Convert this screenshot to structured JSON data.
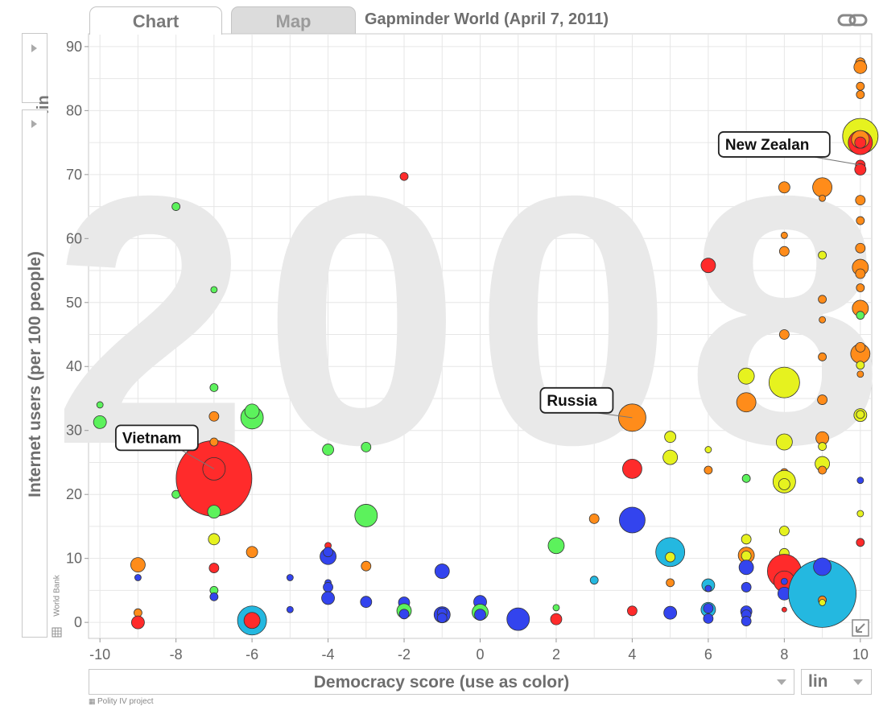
{
  "tabs": {
    "chart": "Chart",
    "map": "Map"
  },
  "title": "Gapminder World (April 7, 2011)",
  "icons": {
    "link": "link-icon",
    "expand": "expand-icon",
    "y_menu": "triangle-right-icon",
    "x_menu": "triangle-down-icon"
  },
  "y_scale": "lin",
  "x_scale": "lin",
  "y_axis_label": "Internet users (per 100 people)",
  "x_axis_label": "Democracy score (use as color)",
  "y_source": "World Bank",
  "x_source": "Polity IV project",
  "chart_data": {
    "type": "scatter",
    "year_watermark": "2008",
    "xlim": [
      -10.3,
      10.3
    ],
    "ylim": [
      -2.5,
      92
    ],
    "xticks": [
      -10,
      -8,
      -6,
      -4,
      -2,
      0,
      2,
      4,
      6,
      8,
      10
    ],
    "yticks": [
      0,
      10,
      20,
      30,
      40,
      50,
      60,
      70,
      80,
      90
    ],
    "grid": true,
    "color_scale": {
      "red": "#ff2b2b",
      "orange": "#ff8c1a",
      "yellow": "#e6f21f",
      "green": "#5cf25c",
      "cyan": "#24b8e0",
      "blue": "#3344ee"
    },
    "labels": [
      {
        "text": "Vietnam",
        "x": -7,
        "y": 24
      },
      {
        "text": "Russia",
        "x": 4,
        "y": 32
      },
      {
        "text": "New Zealan",
        "x": 10,
        "y": 71.5
      }
    ],
    "points": [
      {
        "x": -10,
        "y": 31.3,
        "r": 8,
        "c": "green"
      },
      {
        "x": -10,
        "y": 34,
        "r": 4,
        "c": "green"
      },
      {
        "x": -9,
        "y": 9,
        "r": 9,
        "c": "orange"
      },
      {
        "x": -9,
        "y": 7,
        "r": 4,
        "c": "blue"
      },
      {
        "x": -9,
        "y": 1.5,
        "r": 5,
        "c": "orange"
      },
      {
        "x": -9,
        "y": 0,
        "r": 8,
        "c": "red"
      },
      {
        "x": -8,
        "y": 65,
        "r": 5,
        "c": "green"
      },
      {
        "x": -8,
        "y": 20,
        "r": 5,
        "c": "green"
      },
      {
        "x": -7,
        "y": 22.5,
        "r": 47,
        "c": "red"
      },
      {
        "x": -7,
        "y": 24,
        "r": 14,
        "c": "red"
      },
      {
        "x": -7,
        "y": 52,
        "r": 4,
        "c": "green"
      },
      {
        "x": -7,
        "y": 36.7,
        "r": 5,
        "c": "green"
      },
      {
        "x": -7,
        "y": 32.2,
        "r": 6,
        "c": "orange"
      },
      {
        "x": -7,
        "y": 28.2,
        "r": 5,
        "c": "orange"
      },
      {
        "x": -7,
        "y": 17.3,
        "r": 8,
        "c": "green"
      },
      {
        "x": -7,
        "y": 13,
        "r": 7,
        "c": "yellow"
      },
      {
        "x": -7,
        "y": 8.5,
        "r": 6,
        "c": "red"
      },
      {
        "x": -7,
        "y": 5,
        "r": 5,
        "c": "green"
      },
      {
        "x": -7,
        "y": 4,
        "r": 5,
        "c": "blue"
      },
      {
        "x": -6,
        "y": 32,
        "r": 14,
        "c": "green"
      },
      {
        "x": -6,
        "y": 33,
        "r": 9,
        "c": "green"
      },
      {
        "x": -6,
        "y": 11,
        "r": 7,
        "c": "orange"
      },
      {
        "x": -6,
        "y": 0.3,
        "r": 18,
        "c": "cyan"
      },
      {
        "x": -6,
        "y": 0.3,
        "r": 10,
        "c": "red"
      },
      {
        "x": -5,
        "y": 7,
        "r": 4,
        "c": "blue"
      },
      {
        "x": -5,
        "y": 2,
        "r": 4,
        "c": "blue"
      },
      {
        "x": -4,
        "y": 27,
        "r": 7,
        "c": "green"
      },
      {
        "x": -4,
        "y": 12,
        "r": 4,
        "c": "red"
      },
      {
        "x": -4,
        "y": 10.3,
        "r": 10,
        "c": "blue"
      },
      {
        "x": -4,
        "y": 11,
        "r": 6,
        "c": "blue"
      },
      {
        "x": -4,
        "y": 6.2,
        "r": 4,
        "c": "blue"
      },
      {
        "x": -4,
        "y": 5.5,
        "r": 6,
        "c": "blue"
      },
      {
        "x": -4,
        "y": 3.8,
        "r": 8,
        "c": "blue"
      },
      {
        "x": -3,
        "y": 27.4,
        "r": 6,
        "c": "green"
      },
      {
        "x": -3,
        "y": 16.7,
        "r": 14,
        "c": "green"
      },
      {
        "x": -3,
        "y": 8.8,
        "r": 6,
        "c": "orange"
      },
      {
        "x": -3,
        "y": 3.2,
        "r": 7,
        "c": "blue"
      },
      {
        "x": -2,
        "y": 69.7,
        "r": 5,
        "c": "red"
      },
      {
        "x": -2,
        "y": 3.1,
        "r": 7,
        "c": "blue"
      },
      {
        "x": -2,
        "y": 1.8,
        "r": 9,
        "c": "green"
      },
      {
        "x": -2,
        "y": 1.3,
        "r": 6,
        "c": "blue"
      },
      {
        "x": -1,
        "y": 8,
        "r": 9,
        "c": "blue"
      },
      {
        "x": -1,
        "y": 1.2,
        "r": 10,
        "c": "blue"
      },
      {
        "x": -1,
        "y": 1.5,
        "r": 6,
        "c": "blue"
      },
      {
        "x": -1,
        "y": 0.7,
        "r": 6,
        "c": "blue"
      },
      {
        "x": 0,
        "y": 3.2,
        "r": 8,
        "c": "blue"
      },
      {
        "x": 0,
        "y": 1.6,
        "r": 10,
        "c": "green"
      },
      {
        "x": 0,
        "y": 1.2,
        "r": 7,
        "c": "blue"
      },
      {
        "x": 1,
        "y": 0.5,
        "r": 14,
        "c": "blue"
      },
      {
        "x": 2,
        "y": 12,
        "r": 10,
        "c": "green"
      },
      {
        "x": 2,
        "y": 2.3,
        "r": 4,
        "c": "green"
      },
      {
        "x": 2,
        "y": 0.5,
        "r": 7,
        "c": "red"
      },
      {
        "x": 3,
        "y": 16.2,
        "r": 6,
        "c": "orange"
      },
      {
        "x": 3,
        "y": 6.6,
        "r": 5,
        "c": "cyan"
      },
      {
        "x": 4,
        "y": 32,
        "r": 17,
        "c": "orange"
      },
      {
        "x": 4,
        "y": 24,
        "r": 12,
        "c": "red"
      },
      {
        "x": 4,
        "y": 16,
        "r": 16,
        "c": "blue"
      },
      {
        "x": 4,
        "y": 1.8,
        "r": 6,
        "c": "red"
      },
      {
        "x": 5,
        "y": 29,
        "r": 7,
        "c": "yellow"
      },
      {
        "x": 5,
        "y": 25.8,
        "r": 9,
        "c": "yellow"
      },
      {
        "x": 5,
        "y": 11,
        "r": 18,
        "c": "cyan"
      },
      {
        "x": 5,
        "y": 10.2,
        "r": 6,
        "c": "yellow"
      },
      {
        "x": 5,
        "y": 6.2,
        "r": 5,
        "c": "orange"
      },
      {
        "x": 5,
        "y": 1.5,
        "r": 8,
        "c": "blue"
      },
      {
        "x": 6,
        "y": 55.8,
        "r": 9,
        "c": "red"
      },
      {
        "x": 6,
        "y": 27,
        "r": 4,
        "c": "yellow"
      },
      {
        "x": 6,
        "y": 23.8,
        "r": 5,
        "c": "orange"
      },
      {
        "x": 6,
        "y": 5.8,
        "r": 8,
        "c": "cyan"
      },
      {
        "x": 6,
        "y": 5.3,
        "r": 4,
        "c": "blue"
      },
      {
        "x": 6,
        "y": 2,
        "r": 9,
        "c": "cyan"
      },
      {
        "x": 6,
        "y": 2.2,
        "r": 6,
        "c": "blue"
      },
      {
        "x": 6,
        "y": 0.6,
        "r": 6,
        "c": "blue"
      },
      {
        "x": 7,
        "y": 38.5,
        "r": 10,
        "c": "yellow"
      },
      {
        "x": 7,
        "y": 34.4,
        "r": 12,
        "c": "orange"
      },
      {
        "x": 7,
        "y": 22.5,
        "r": 5,
        "c": "green"
      },
      {
        "x": 7,
        "y": 13,
        "r": 6,
        "c": "yellow"
      },
      {
        "x": 7,
        "y": 10.5,
        "r": 10,
        "c": "orange"
      },
      {
        "x": 7,
        "y": 10.4,
        "r": 6,
        "c": "yellow"
      },
      {
        "x": 7,
        "y": 8.6,
        "r": 9,
        "c": "blue"
      },
      {
        "x": 7,
        "y": 5.5,
        "r": 6,
        "c": "blue"
      },
      {
        "x": 7,
        "y": 1.7,
        "r": 7,
        "c": "blue"
      },
      {
        "x": 7,
        "y": 1.2,
        "r": 6,
        "c": "blue"
      },
      {
        "x": 7,
        "y": 0.2,
        "r": 6,
        "c": "blue"
      },
      {
        "x": 8,
        "y": 75.5,
        "r": 6,
        "c": "red"
      },
      {
        "x": 8,
        "y": 68,
        "r": 7,
        "c": "orange"
      },
      {
        "x": 8,
        "y": 60.5,
        "r": 4,
        "c": "orange"
      },
      {
        "x": 8,
        "y": 58,
        "r": 6,
        "c": "orange"
      },
      {
        "x": 8,
        "y": 45,
        "r": 6,
        "c": "orange"
      },
      {
        "x": 8,
        "y": 37.5,
        "r": 19,
        "c": "yellow"
      },
      {
        "x": 8,
        "y": 28.2,
        "r": 10,
        "c": "yellow"
      },
      {
        "x": 8,
        "y": 23.4,
        "r": 5,
        "c": "orange"
      },
      {
        "x": 8,
        "y": 22,
        "r": 14,
        "c": "yellow"
      },
      {
        "x": 8,
        "y": 21.6,
        "r": 7,
        "c": "yellow"
      },
      {
        "x": 8,
        "y": 14.3,
        "r": 6,
        "c": "yellow"
      },
      {
        "x": 8,
        "y": 10.8,
        "r": 6,
        "c": "yellow"
      },
      {
        "x": 8,
        "y": 8,
        "r": 21,
        "c": "red"
      },
      {
        "x": 8,
        "y": 6.4,
        "r": 13,
        "c": "red"
      },
      {
        "x": 8,
        "y": 6.4,
        "r": 4,
        "c": "blue"
      },
      {
        "x": 8,
        "y": 4.5,
        "r": 8,
        "c": "blue"
      },
      {
        "x": 8,
        "y": 2,
        "r": 3,
        "c": "red"
      },
      {
        "x": 9,
        "y": 68,
        "r": 12,
        "c": "orange"
      },
      {
        "x": 9,
        "y": 66.3,
        "r": 4,
        "c": "orange"
      },
      {
        "x": 9,
        "y": 57.4,
        "r": 5,
        "c": "yellow"
      },
      {
        "x": 9,
        "y": 50.5,
        "r": 5,
        "c": "orange"
      },
      {
        "x": 9,
        "y": 47.3,
        "r": 4,
        "c": "orange"
      },
      {
        "x": 9,
        "y": 41.5,
        "r": 5,
        "c": "orange"
      },
      {
        "x": 9,
        "y": 34.8,
        "r": 6,
        "c": "orange"
      },
      {
        "x": 9,
        "y": 28.8,
        "r": 8,
        "c": "orange"
      },
      {
        "x": 9,
        "y": 27.5,
        "r": 5,
        "c": "yellow"
      },
      {
        "x": 9,
        "y": 24.8,
        "r": 9,
        "c": "yellow"
      },
      {
        "x": 9,
        "y": 23.8,
        "r": 5,
        "c": "orange"
      },
      {
        "x": 9,
        "y": 4.5,
        "r": 42,
        "c": "cyan"
      },
      {
        "x": 9,
        "y": 8.7,
        "r": 11,
        "c": "blue"
      },
      {
        "x": 9,
        "y": 3.5,
        "r": 5,
        "c": "orange"
      },
      {
        "x": 9,
        "y": 3.1,
        "r": 4,
        "c": "yellow"
      },
      {
        "x": 10,
        "y": 87.5,
        "r": 6,
        "c": "orange"
      },
      {
        "x": 10,
        "y": 86.8,
        "r": 8,
        "c": "orange"
      },
      {
        "x": 10,
        "y": 83.8,
        "r": 5,
        "c": "orange"
      },
      {
        "x": 10,
        "y": 82.5,
        "r": 5,
        "c": "orange"
      },
      {
        "x": 10,
        "y": 76,
        "r": 22,
        "c": "yellow"
      },
      {
        "x": 10,
        "y": 75,
        "r": 15,
        "c": "red"
      },
      {
        "x": 10,
        "y": 75.5,
        "r": 11,
        "c": "orange"
      },
      {
        "x": 10,
        "y": 75,
        "r": 7,
        "c": "red"
      },
      {
        "x": 10,
        "y": 71.5,
        "r": 6,
        "c": "red"
      },
      {
        "x": 10,
        "y": 70.8,
        "r": 7,
        "c": "red"
      },
      {
        "x": 10,
        "y": 66,
        "r": 6,
        "c": "orange"
      },
      {
        "x": 10,
        "y": 62.8,
        "r": 5,
        "c": "orange"
      },
      {
        "x": 10,
        "y": 58.5,
        "r": 6,
        "c": "orange"
      },
      {
        "x": 10,
        "y": 55.5,
        "r": 10,
        "c": "orange"
      },
      {
        "x": 10,
        "y": 54.5,
        "r": 6,
        "c": "orange"
      },
      {
        "x": 10,
        "y": 52.3,
        "r": 5,
        "c": "orange"
      },
      {
        "x": 10,
        "y": 49.1,
        "r": 10,
        "c": "orange"
      },
      {
        "x": 10,
        "y": 48,
        "r": 5,
        "c": "green"
      },
      {
        "x": 10,
        "y": 42,
        "r": 12,
        "c": "orange"
      },
      {
        "x": 10,
        "y": 43,
        "r": 6,
        "c": "orange"
      },
      {
        "x": 10,
        "y": 40.2,
        "r": 5,
        "c": "yellow"
      },
      {
        "x": 10,
        "y": 38.8,
        "r": 4,
        "c": "orange"
      },
      {
        "x": 10,
        "y": 32.4,
        "r": 8,
        "c": "yellow"
      },
      {
        "x": 10,
        "y": 32.5,
        "r": 5,
        "c": "yellow"
      },
      {
        "x": 10,
        "y": 22.2,
        "r": 4,
        "c": "blue"
      },
      {
        "x": 10,
        "y": 17,
        "r": 4,
        "c": "yellow"
      },
      {
        "x": 10,
        "y": 12.5,
        "r": 5,
        "c": "red"
      }
    ]
  }
}
